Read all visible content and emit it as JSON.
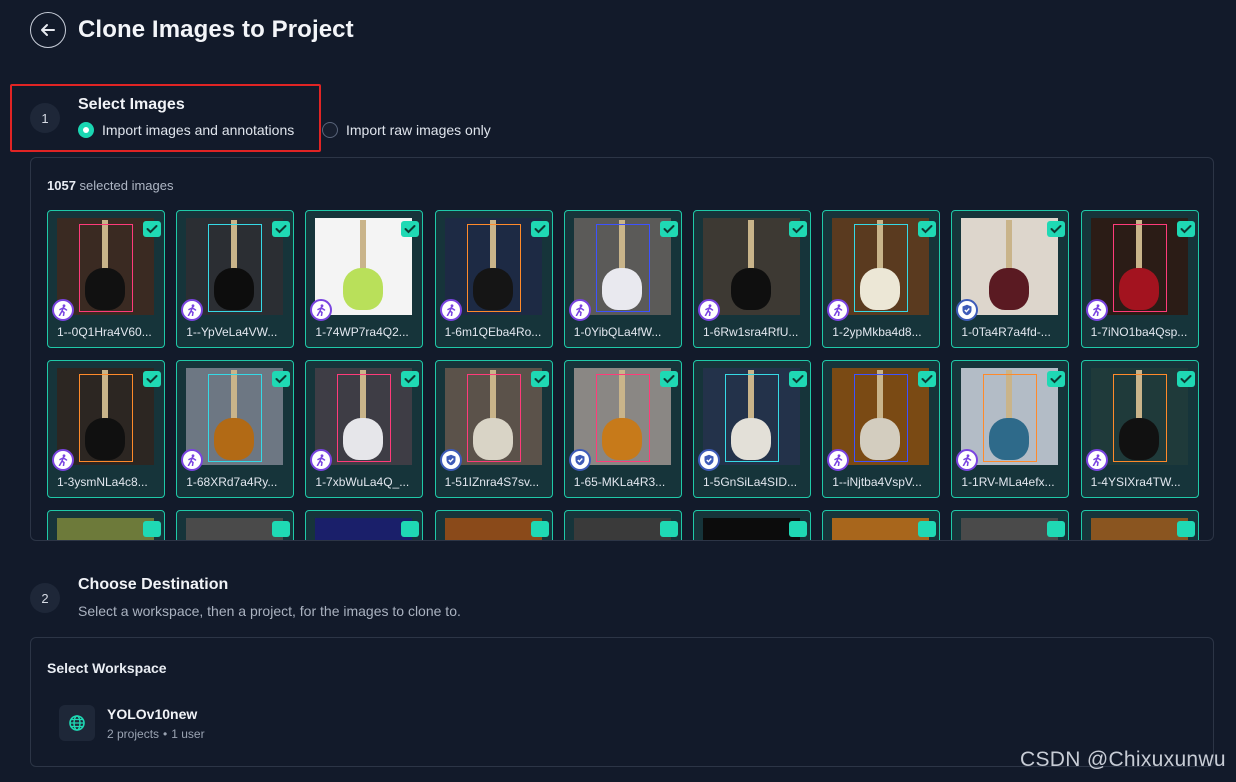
{
  "header": {
    "title": "Clone Images to Project",
    "back_icon": "arrow-left-icon"
  },
  "step1": {
    "number": "1",
    "title": "Select Images",
    "options": [
      {
        "label": "Import images and annotations",
        "selected": true
      },
      {
        "label": "Import raw images only",
        "selected": false
      }
    ],
    "count": "1057",
    "count_suffix": " selected images",
    "images": [
      {
        "label": "1--0Q1Hra4V60...",
        "badge": "person-icon",
        "bg": "#3a2a22",
        "body": "#111111",
        "box": "pink"
      },
      {
        "label": "1--YpVeLa4VW...",
        "badge": "person-icon",
        "bg": "#2b2e33",
        "body": "#0d0d0d",
        "box": "cyan"
      },
      {
        "label": "1-74WP7ra4Q2...",
        "badge": "person-icon",
        "bg": "#f4f4f4",
        "body": "#b9e05a",
        "box": "none"
      },
      {
        "label": "1-6m1QEba4Ro...",
        "badge": "person-icon",
        "bg": "#1d2a44",
        "body": "#151515",
        "box": "orange"
      },
      {
        "label": "1-0YibQLa4fW...",
        "badge": "person-icon",
        "bg": "#5b5a58",
        "body": "#e9e9ef",
        "box": "blue"
      },
      {
        "label": "1-6Rw1sra4RfU...",
        "badge": "person-icon",
        "bg": "#3d3933",
        "body": "#0f0f0f",
        "box": "none"
      },
      {
        "label": "1-2ypMkba4d8...",
        "badge": "person-icon",
        "bg": "#5a3a1f",
        "body": "#ece7d6",
        "box": "cyan"
      },
      {
        "label": "1-0Ta4R7a4fd-...",
        "badge": "shield-icon",
        "bg": "#ddd6cc",
        "body": "#5a1a22",
        "box": "none"
      },
      {
        "label": "1-7iNO1ba4Qsp...",
        "badge": "person-icon",
        "bg": "#2b1c16",
        "body": "#a3131f",
        "box": "pink"
      },
      {
        "label": "1-3ysmNLa4c8...",
        "badge": "person-icon",
        "bg": "#2c2622",
        "body": "#101010",
        "box": "orange"
      },
      {
        "label": "1-68XRd7a4Ry...",
        "badge": "person-icon",
        "bg": "#6d7783",
        "body": "#b26a15",
        "box": "cyan"
      },
      {
        "label": "1-7xbWuLa4Q_...",
        "badge": "person-icon",
        "bg": "#3e3d45",
        "body": "#e6e6ea",
        "box": "pink"
      },
      {
        "label": "1-51IZnra4S7sv...",
        "badge": "shield-icon",
        "bg": "#5b524a",
        "body": "#d9d4c6",
        "box": "pink"
      },
      {
        "label": "1-65-MKLa4R3...",
        "badge": "shield-icon",
        "bg": "#8a8784",
        "body": "#c77a1a",
        "box": "pink"
      },
      {
        "label": "1-5GnSiLa4SID...",
        "badge": "shield-icon",
        "bg": "#23324a",
        "body": "#e3e0d8",
        "box": "cyan"
      },
      {
        "label": "1--iNjtba4VspV...",
        "badge": "person-icon",
        "bg": "#7a4a14",
        "body": "#d3cdbf",
        "box": "blue"
      },
      {
        "label": "1-1RV-MLa4efx...",
        "badge": "person-icon",
        "bg": "#b3bcc6",
        "body": "#2e6a8a",
        "box": "orange"
      },
      {
        "label": "1-4YSIXra4TW...",
        "badge": "person-icon",
        "bg": "#1f3a3a",
        "body": "#111111",
        "box": "orange"
      }
    ],
    "partial_row_colors": [
      "#6d7a3a",
      "#4a4a4a",
      "#1a1f6a",
      "#8a4a1a",
      "#3a3a3a",
      "#0c0c0c",
      "#a8661c",
      "#4a4a4a",
      "#8a5520"
    ]
  },
  "step2": {
    "number": "2",
    "title": "Choose Destination",
    "subtitle": "Select a workspace, then a project, for the images to clone to.",
    "select_workspace_label": "Select Workspace",
    "workspace": {
      "name": "YOLOv10new",
      "projects": "2 projects",
      "users": "1 user",
      "icon": "globe-icon"
    }
  },
  "watermark": "CSDN @Chixuxunwu",
  "colors": {
    "accent": "#1fd9b4",
    "highlight": "#e02424",
    "background": "#121a2a"
  }
}
